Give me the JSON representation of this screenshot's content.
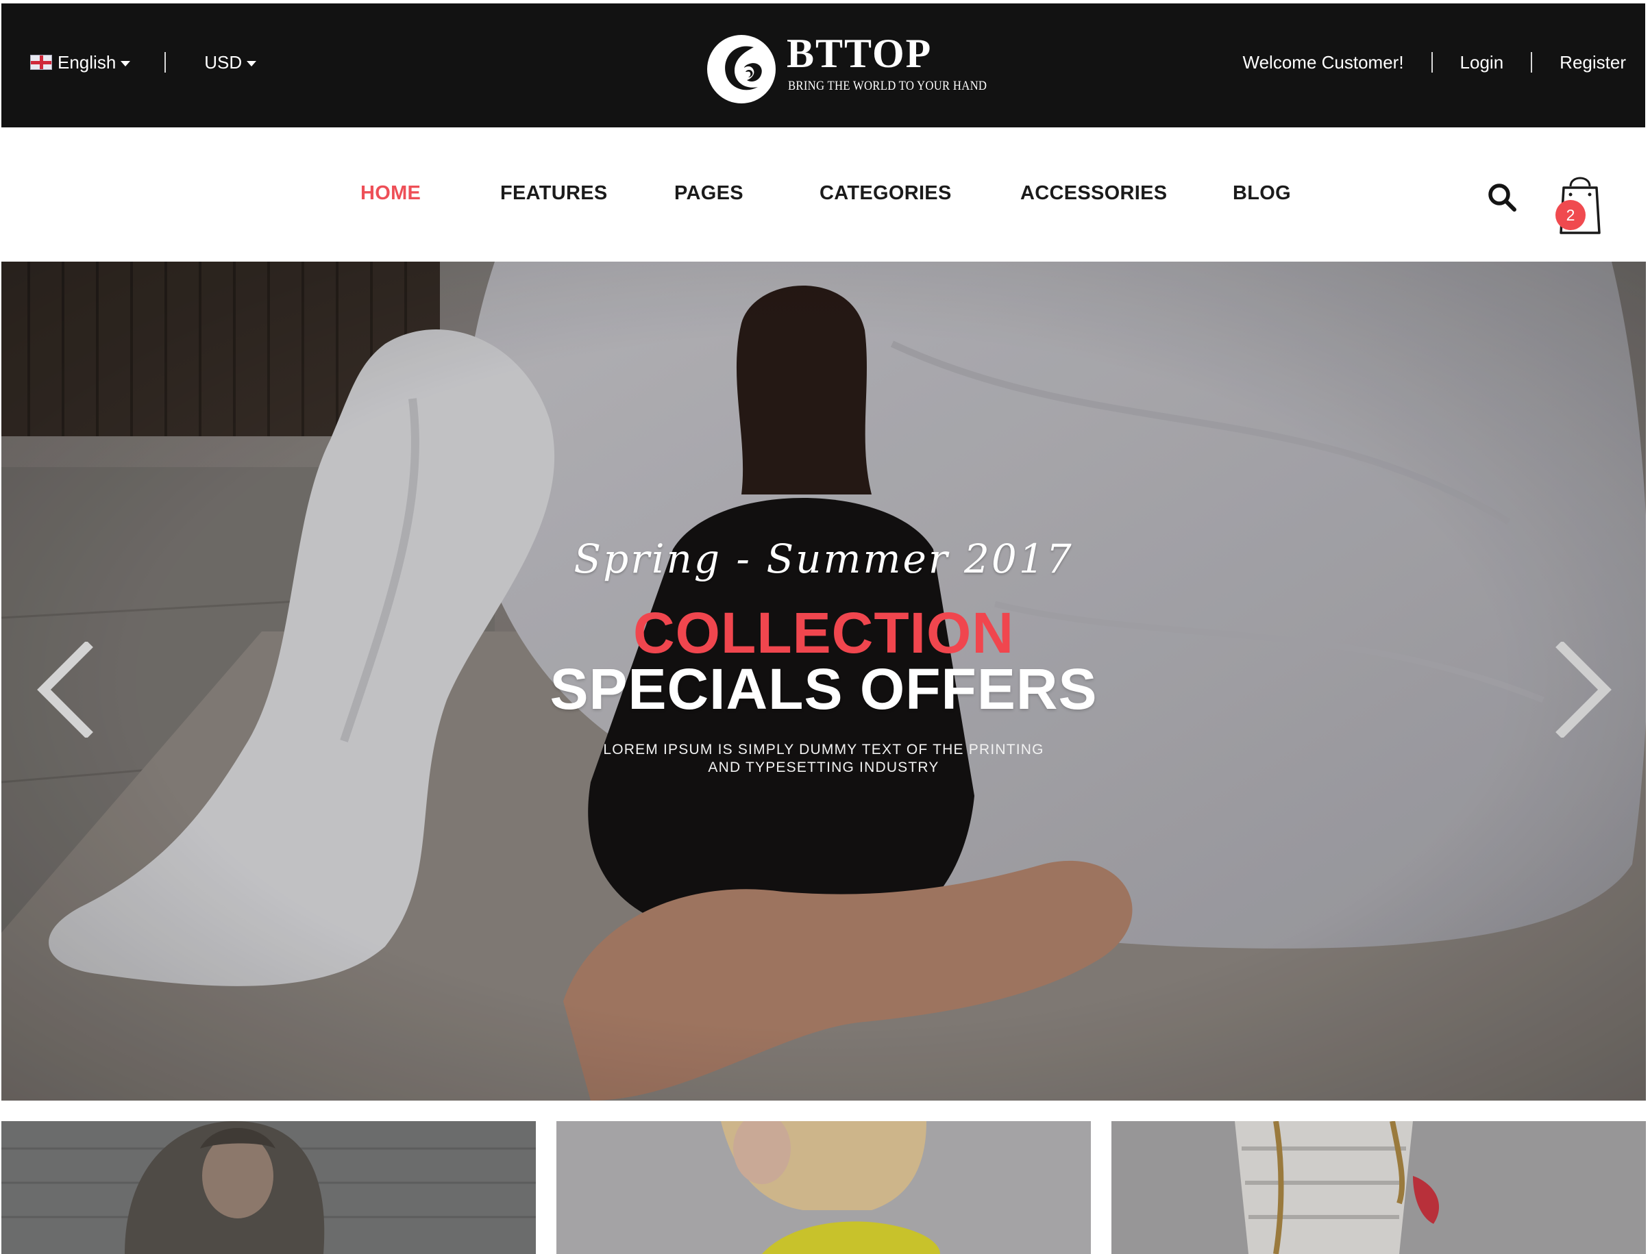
{
  "topbar": {
    "language": "English",
    "currency": "USD",
    "welcome": "Welcome Customer!",
    "login": "Login",
    "register": "Register"
  },
  "logo": {
    "name": "BTTOP",
    "tagline": "BRING THE WORLD TO YOUR HAND"
  },
  "nav": {
    "items": [
      {
        "label": "HOME",
        "active": true
      },
      {
        "label": "FEATURES"
      },
      {
        "label": "PAGES"
      },
      {
        "label": "CATEGORIES"
      },
      {
        "label": "ACCESSORIES"
      },
      {
        "label": "BLOG"
      }
    ],
    "cart_count": "2"
  },
  "hero": {
    "script": "Spring - Summer 2017",
    "headline_accent": "COLLECTION",
    "headline": "SPECIALS OFFERS",
    "desc_line1": "LOREM IPSUM IS SIMPLY DUMMY TEXT OF THE PRINTING",
    "desc_line2": "AND TYPESETTING INDUSTRY"
  },
  "icons": {
    "flag": "uk-flag-icon",
    "search": "search-icon",
    "cart": "shopping-bag-icon",
    "prev": "chevron-left-icon",
    "next": "chevron-right-icon"
  },
  "colors": {
    "topbar": "#121212",
    "accent": "#ee4f57",
    "badge": "#f04a4f"
  }
}
